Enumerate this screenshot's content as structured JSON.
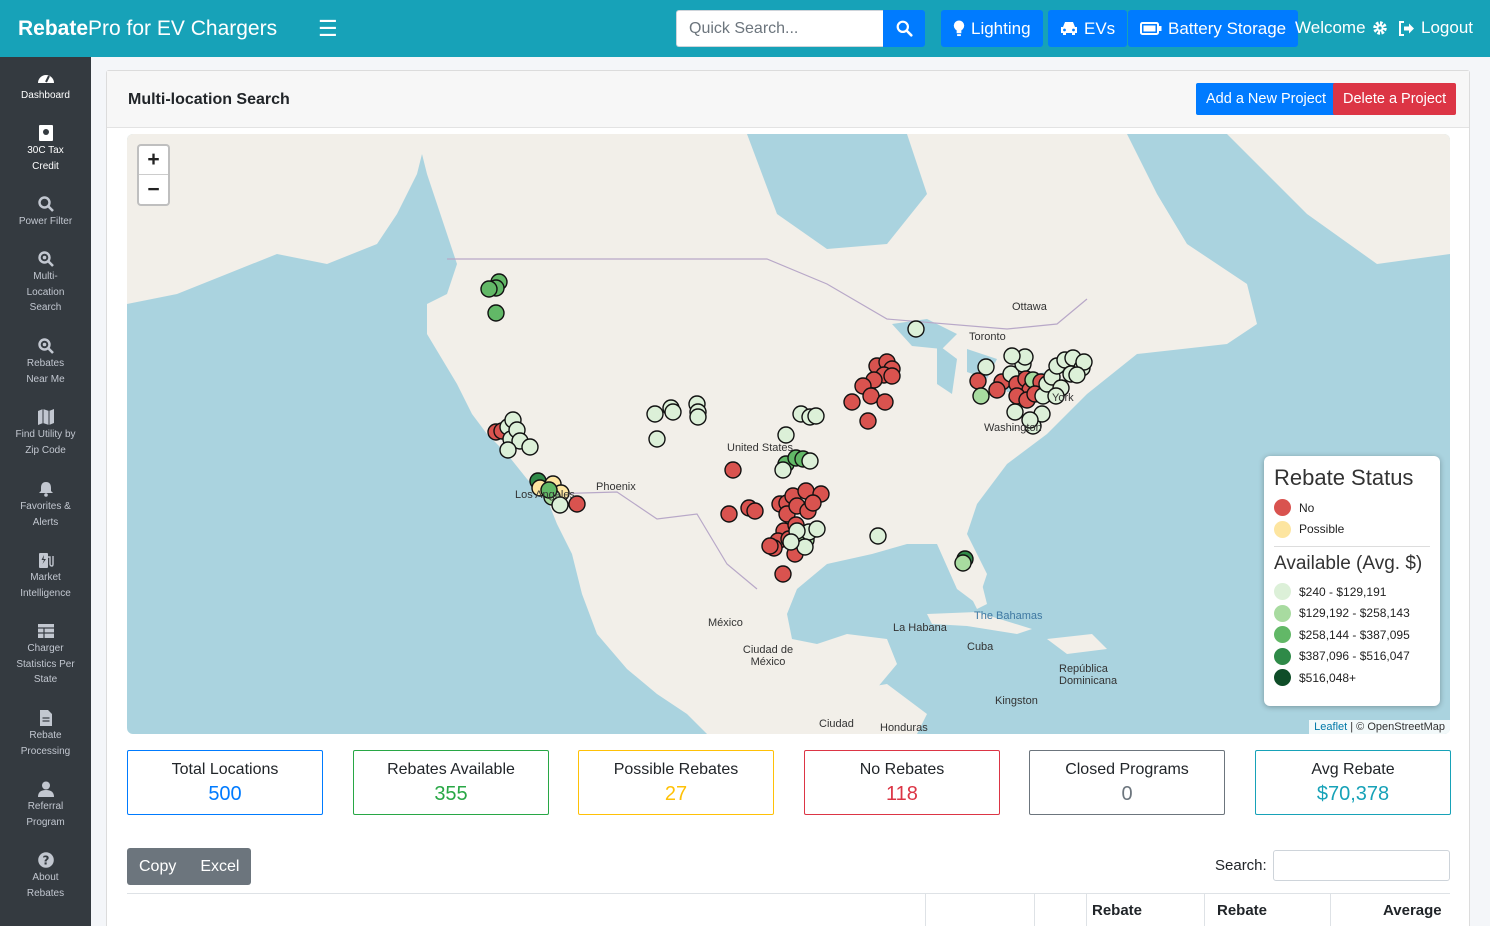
{
  "app": {
    "brand_bold": "Rebate",
    "brand_rest": "Pro for EV Chargers"
  },
  "topbar": {
    "search_placeholder": "Quick Search...",
    "buttons": {
      "lighting": "Lighting",
      "evs": "EVs",
      "battery": "Battery Storage"
    },
    "welcome": "Welcome",
    "logout": "Logout"
  },
  "sidebar": {
    "items": [
      {
        "label": "Dashboard",
        "icon": "tachometer-icon"
      },
      {
        "label": "30C Tax Credit",
        "icon": "certificate-icon"
      },
      {
        "label": "Power Filter",
        "icon": "search-icon"
      },
      {
        "label": "Multi-Location Search",
        "icon": "search-location-icon"
      },
      {
        "label": "Rebates Near Me",
        "icon": "search-location-icon"
      },
      {
        "label": "Find Utility by Zip Code",
        "icon": "map-icon"
      },
      {
        "label": "Favorites & Alerts",
        "icon": "bell-icon"
      },
      {
        "label": "Market Intelligence",
        "icon": "charging-station-icon"
      },
      {
        "label": "Charger Statistics Per State",
        "icon": "table-icon"
      },
      {
        "label": "Rebate Processing",
        "icon": "file-icon"
      },
      {
        "label": "Referral Program",
        "icon": "user-icon"
      },
      {
        "label": "About Rebates",
        "icon": "question-circle-icon"
      }
    ]
  },
  "page": {
    "title": "Multi-location Search",
    "add_button": "Add a New Project",
    "delete_button": "Delete a Project"
  },
  "map": {
    "zoom_in": "+",
    "zoom_out": "−",
    "labels": [
      "Ottawa",
      "Toronto",
      "Washington",
      "York",
      "United States",
      "Phoenix",
      "Los Angeles",
      "México",
      "Ciudad de México",
      "La Habana",
      "The Bahamas",
      "Cuba",
      "República Dominicana",
      "Kingston",
      "Ciudad",
      "Honduras"
    ],
    "legend": {
      "title": "Rebate Status",
      "status": [
        {
          "label": "No",
          "color": "#d9534f"
        },
        {
          "label": "Possible",
          "color": "#fde5a0"
        }
      ],
      "available_title": "Available (Avg. $)",
      "available": [
        {
          "label": "$240 - $129,191",
          "color": "#dcf0d8"
        },
        {
          "label": "$129,192 - $258,143",
          "color": "#a8dba0"
        },
        {
          "label": "$258,144 - $387,095",
          "color": "#62b867"
        },
        {
          "label": "$387,096 - $516,047",
          "color": "#2f8a48"
        },
        {
          "label": "$516,048+",
          "color": "#0f4d28"
        }
      ]
    },
    "attribution_link": "Leaflet",
    "attribution_text": "| © OpenStreetMap"
  },
  "stats": [
    {
      "label": "Total Locations",
      "value": "500",
      "color": "#007bff"
    },
    {
      "label": "Rebates Available",
      "value": "355",
      "color": "#28a745"
    },
    {
      "label": "Possible Rebates",
      "value": "27",
      "color": "#ffc107"
    },
    {
      "label": "No Rebates",
      "value": "118",
      "color": "#dc3545"
    },
    {
      "label": "Closed Programs",
      "value": "0",
      "color": "#6c757d"
    },
    {
      "label": "Avg Rebate",
      "value": "$70,378",
      "color": "#17a2b8"
    }
  ],
  "table": {
    "copy": "Copy",
    "excel": "Excel",
    "search_label": "Search:",
    "headers": [
      "Rebate",
      "Rebate",
      "Average"
    ]
  }
}
